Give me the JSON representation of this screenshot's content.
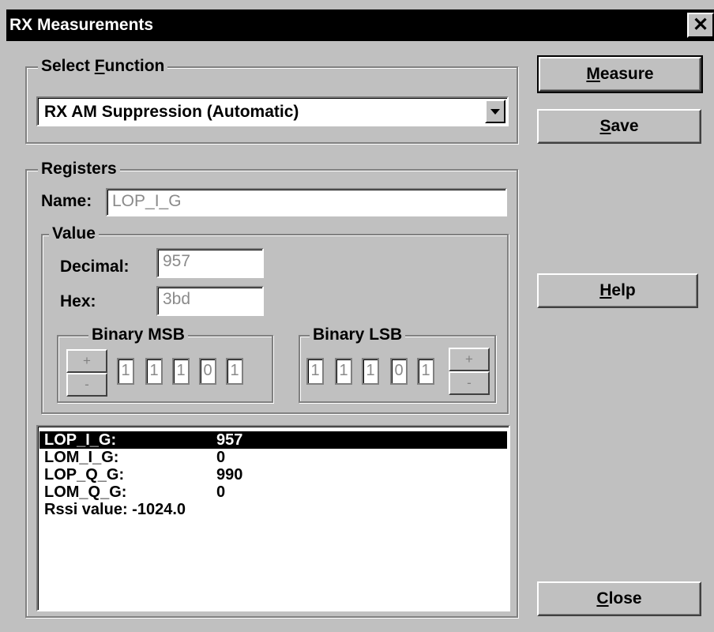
{
  "window": {
    "title": "RX Measurements",
    "close_glyph": "✕"
  },
  "select_function": {
    "group_label": "Select Function",
    "group_label_access_key": "F",
    "selected": "RX AM Suppression (Automatic)"
  },
  "registers": {
    "group_label": "Registers",
    "name_label": "Name:",
    "name_value": "LOP_I_G",
    "value": {
      "group_label": "Value",
      "decimal_label": "Decimal:",
      "decimal_value": "957",
      "hex_label": "Hex:",
      "hex_value": "3bd",
      "binary_msb": {
        "label": "Binary MSB",
        "bits": [
          "1",
          "1",
          "1",
          "0",
          "1"
        ],
        "plus": "+",
        "minus": "-"
      },
      "binary_lsb": {
        "label": "Binary LSB",
        "bits": [
          "1",
          "1",
          "1",
          "0",
          "1"
        ],
        "plus": "+",
        "minus": "-"
      }
    }
  },
  "results": [
    {
      "name": "LOP_I_G:",
      "value": "957",
      "selected": true
    },
    {
      "name": "LOM_I_G:",
      "value": "0",
      "selected": false
    },
    {
      "name": "LOP_Q_G:",
      "value": "990",
      "selected": false
    },
    {
      "name": "LOM_Q_G:",
      "value": "0",
      "selected": false
    },
    {
      "name": "Rssi value: -1024.0",
      "value": "",
      "selected": false
    }
  ],
  "buttons": {
    "measure": {
      "label": "Measure",
      "access_key": "M",
      "rest": "easure"
    },
    "save": {
      "label": "Save",
      "access_key": "S",
      "rest": "ave"
    },
    "help": {
      "label": "Help",
      "access_key": "H",
      "rest": "elp"
    },
    "close": {
      "label": "Close",
      "access_key": "C",
      "rest": "lose"
    }
  },
  "colors": {
    "face": "#c0c0c0",
    "title_bar": "#000000",
    "disabled_text": "#8a8a8a"
  }
}
